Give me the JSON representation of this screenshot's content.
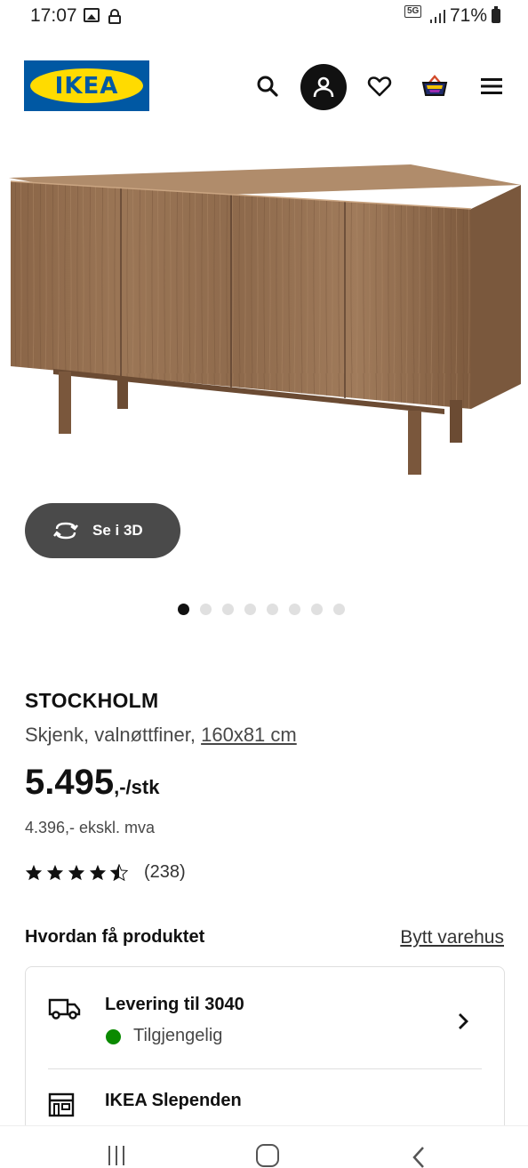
{
  "status_bar": {
    "time": "17:07",
    "network": "5G",
    "battery": "71%"
  },
  "header": {
    "logo_text": "IKEA",
    "brand_colors": {
      "blue": "#0058a3",
      "yellow": "#ffdb00"
    },
    "icons": [
      "search-icon",
      "account-icon",
      "heart-icon",
      "cart-icon",
      "menu-icon"
    ]
  },
  "gallery": {
    "view_3d_label": "Se i 3D",
    "image_count": 8,
    "active_index": 0
  },
  "product": {
    "name": "STOCKHOLM",
    "description": "Skjenk, valnøttfiner,",
    "measurement": "160x81 cm",
    "price_main": "5.495",
    "price_suffix": ",-/stk",
    "price_excl_vat": "4.396,- ekskl. mva",
    "rating_value": 4.5,
    "rating_max": 5,
    "review_count": "(238)"
  },
  "fulfillment": {
    "title": "Hvordan få produktet",
    "change_store_label": "Bytt varehus",
    "delivery_label": "Levering til 3040",
    "availability_label": "Tilgjengelig",
    "availability_color": "#0a8a00",
    "store_label": "IKEA Slependen"
  }
}
